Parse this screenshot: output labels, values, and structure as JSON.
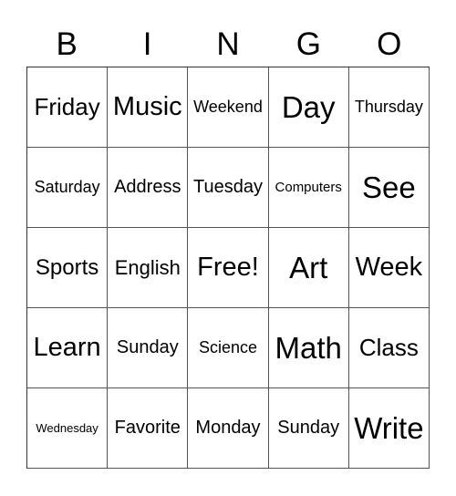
{
  "card": {
    "header": [
      "B",
      "I",
      "N",
      "G",
      "O"
    ],
    "rows": [
      [
        "Friday",
        "Music",
        "Weekend",
        "Day",
        "Thursday"
      ],
      [
        "Saturday",
        "Address",
        "Tuesday",
        "Computers",
        "See"
      ],
      [
        "Sports",
        "English",
        "Free!",
        "Art",
        "Week"
      ],
      [
        "Learn",
        "Sunday",
        "Science",
        "Math",
        "Class"
      ],
      [
        "Wednesday",
        "Favorite",
        "Monday",
        "Sunday",
        "Write"
      ]
    ]
  }
}
